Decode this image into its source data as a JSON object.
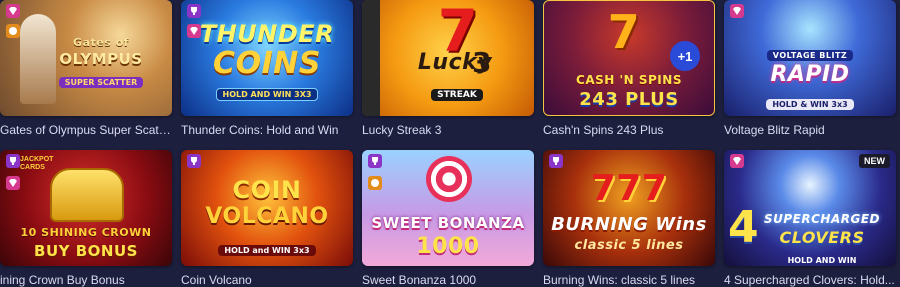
{
  "games": [
    {
      "title": "Gates of Olympus Super Scatter",
      "logo": [
        "Gates of",
        "OLYMPUS"
      ],
      "sub": "SUPER SCATTER",
      "badges": [
        "diamond",
        "coin"
      ],
      "bg": "#6f4b2e"
    },
    {
      "title": "Thunder Coins: Hold and Win",
      "logo": [
        "THUNDER",
        "COINS"
      ],
      "sub": "HOLD AND WIN 3X3",
      "badges": [
        "trophy",
        "diamond"
      ],
      "bg": "#1d5fc4"
    },
    {
      "title": "Lucky Streak 3",
      "logo": [
        "Lucky",
        "3"
      ],
      "sub": "STREAK",
      "badges": [],
      "bg": "#f0a010"
    },
    {
      "title": "Cash'n Spins 243 Plus",
      "logo": [
        "CASH 'N SPINS",
        "243 PLUS"
      ],
      "sub": "+1",
      "badges": [],
      "bg": "#5a1c6a"
    },
    {
      "title": "Voltage Blitz Rapid",
      "logo": [
        "VOLTAGE BLITZ",
        "RAPID"
      ],
      "sub": "HOLD & WIN 3x3",
      "badges": [
        "diamond"
      ],
      "bg": "#2a3a8a"
    },
    {
      "title": "ining Crown Buy Bonus",
      "logo": [
        "10 SHINING CROWN",
        "BUY BONUS"
      ],
      "sub": "JACKPOT CARDS",
      "badges": [
        "trophy",
        "diamond"
      ],
      "bg": "#6e0d14"
    },
    {
      "title": "Coin Volcano",
      "logo": [
        "COIN",
        "VOLCANO"
      ],
      "sub": "HOLD and WIN 3x3",
      "badges": [
        "trophy"
      ],
      "bg": "#b3200e"
    },
    {
      "title": "Sweet Bonanza 1000",
      "logo": [
        "SWEET BONANZA",
        "1000"
      ],
      "sub": "",
      "badges": [
        "trophy",
        "coin"
      ],
      "bg": "#b07ad6"
    },
    {
      "title": "Burning Wins: classic 5 lines",
      "logo": [
        "BURNING Wins",
        "classic 5 lines"
      ],
      "sub": "777",
      "badges": [
        "trophy"
      ],
      "bg": "#6a1a0c"
    },
    {
      "title": "4 Supercharged Clovers: Hold...",
      "logo": [
        "SUPERCHARGED",
        "CLOVERS"
      ],
      "sub": "HOLD AND WIN",
      "badges": [
        "diamond"
      ],
      "bg": "#1a2a6a",
      "new": "NEW"
    }
  ]
}
